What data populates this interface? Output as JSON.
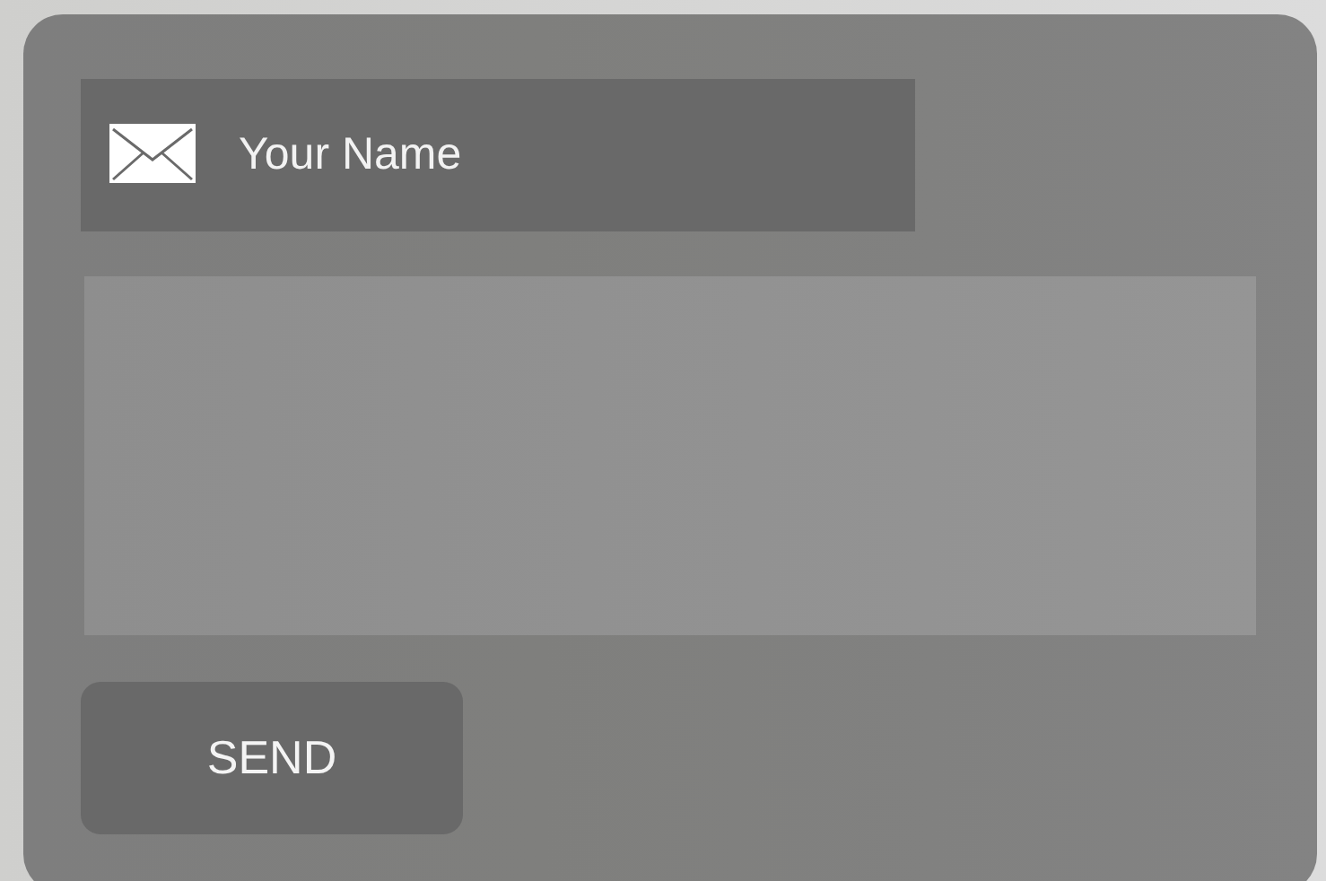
{
  "name_field": {
    "placeholder": "Your Name"
  },
  "send_button": {
    "label": "SEND"
  }
}
